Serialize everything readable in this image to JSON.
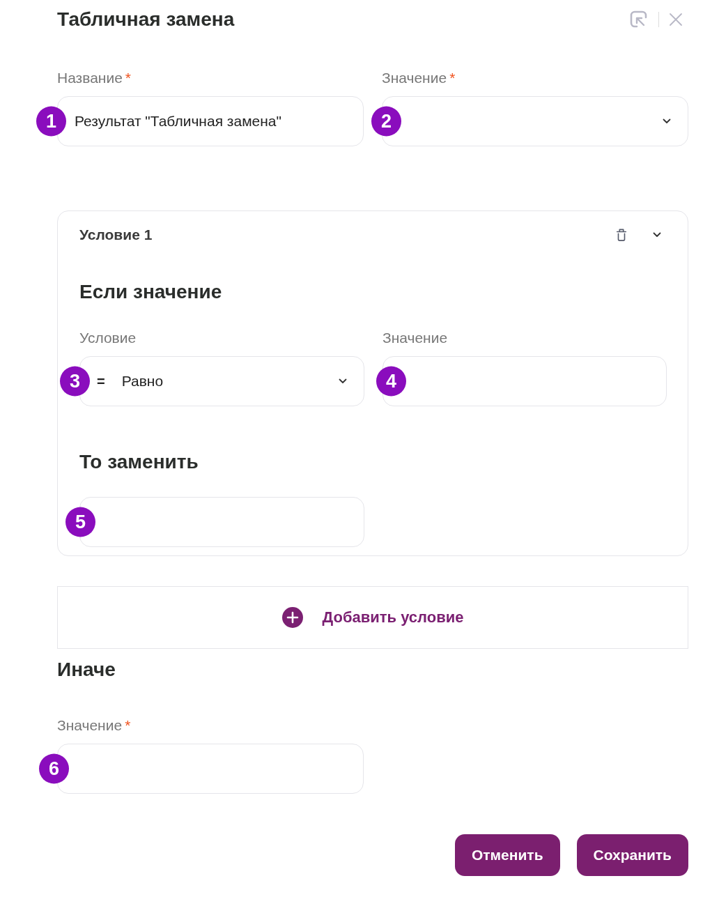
{
  "dialog": {
    "title": "Табличная замена"
  },
  "fields": [
    {
      "label": "Название",
      "required_mark": "*",
      "value": "Результат \"Табличная замена\"",
      "kind": "text",
      "badge": "1"
    },
    {
      "label": "Значение",
      "required_mark": "*",
      "kind": "select",
      "badge": "2"
    }
  ],
  "conditions": [
    {
      "title": "Условие 1",
      "if_heading": "Если значение",
      "condition_field": {
        "label": "Условие",
        "operator": "=",
        "value": "Равно",
        "badge": "3"
      },
      "value_field": {
        "label": "Значение",
        "badge": "4"
      },
      "then_heading": "То заменить",
      "replace_field": {
        "badge": "5"
      }
    }
  ],
  "add_condition": "Добавить условие",
  "else": {
    "heading": "Иначе",
    "field": {
      "label": "Значение",
      "required_mark": "*",
      "badge": "6"
    }
  },
  "buttons": [
    "Отменить",
    "Сохранить"
  ]
}
